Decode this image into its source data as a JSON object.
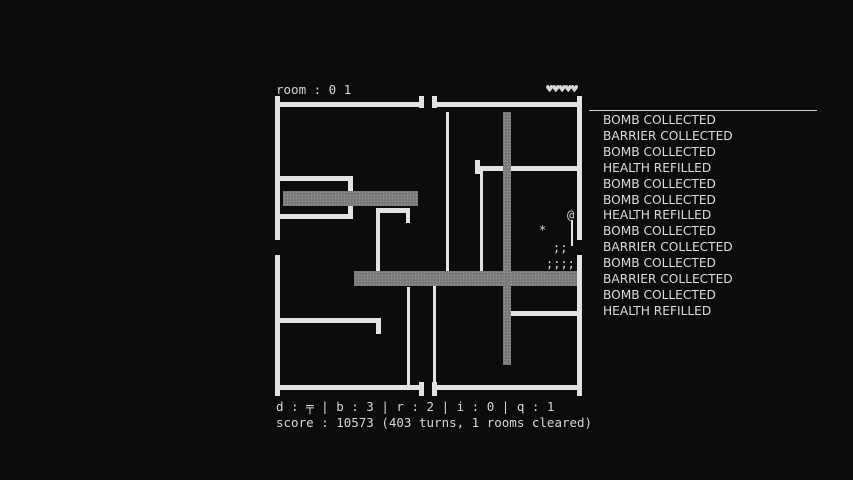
{
  "header": {
    "room_label": "room : 0 1",
    "hearts": "♥♥♥♥♥"
  },
  "map": {
    "player": "@",
    "bomb": "*",
    "rubble_1": ";;",
    "rubble_2": ";;;;"
  },
  "message_log": [
    "BOMB COLLECTED",
    "BARRIER COLLECTED",
    "BOMB COLLECTED",
    "HEALTH REFILLED",
    "BOMB COLLECTED",
    "BOMB COLLECTED",
    "HEALTH REFILLED",
    "BOMB COLLECTED",
    "BARRIER COLLECTED",
    "BOMB COLLECTED",
    "BARRIER COLLECTED",
    "BOMB COLLECTED",
    "HEALTH REFILLED"
  ],
  "footer": {
    "stats": "d : ╤ | b : 3 | r : 2 | i : 0 | q : 1",
    "score": "score : 10573 (403 turns, 1 rooms cleared)"
  }
}
